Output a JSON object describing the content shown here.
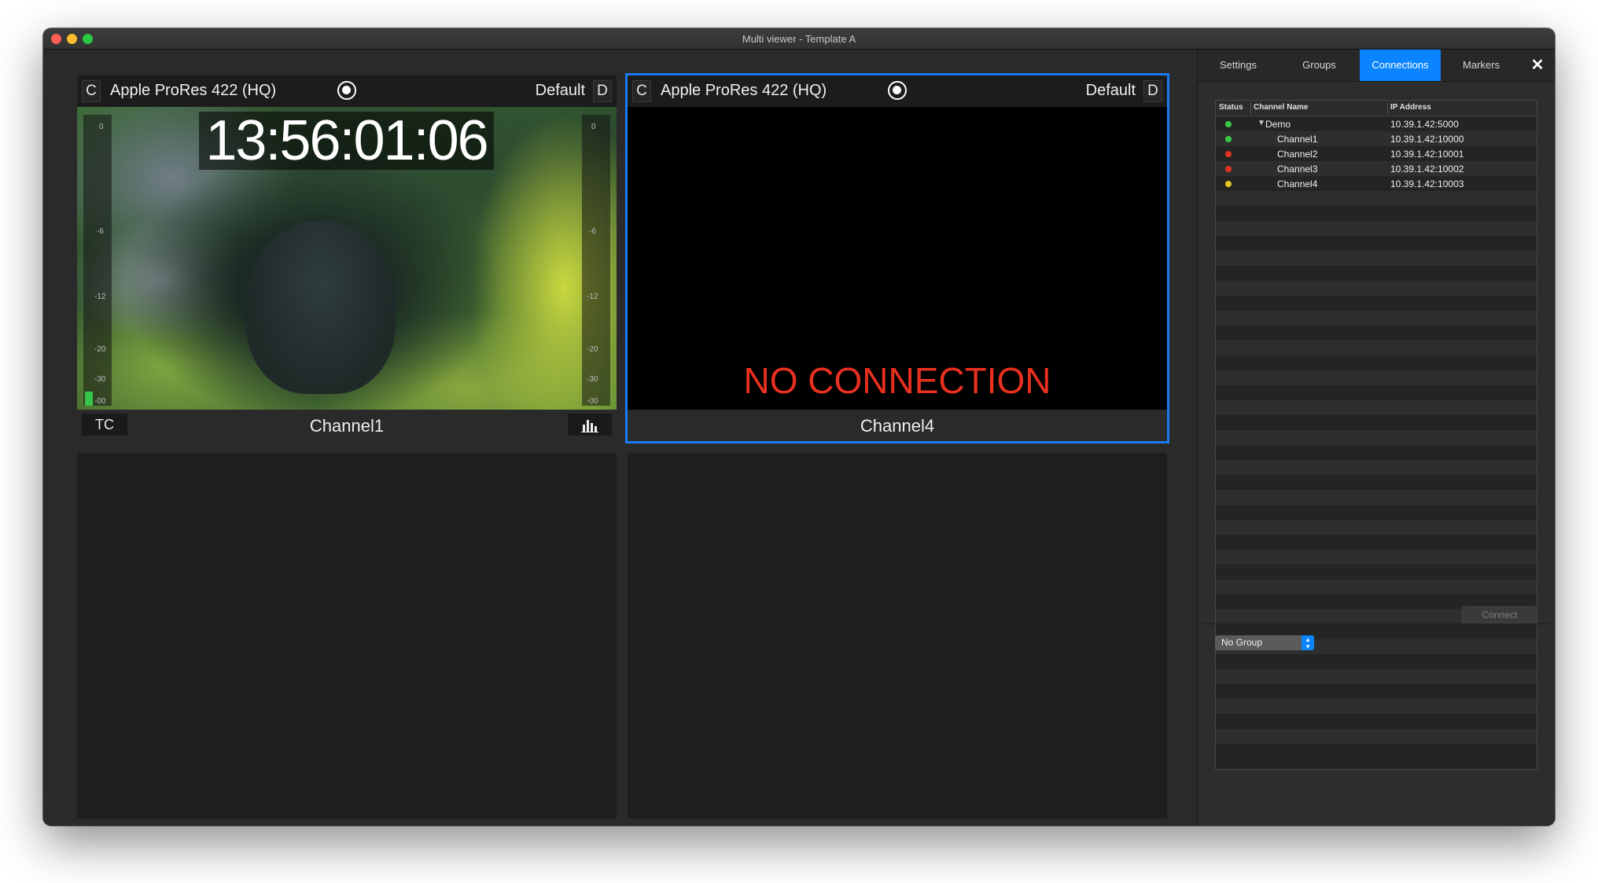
{
  "window": {
    "title": "Multi viewer - Template A"
  },
  "tiles": [
    {
      "left_box": "C",
      "codec": "Apple ProRes 422 (HQ)",
      "preset": "Default",
      "right_box": "D",
      "timecode": "13:56:01:06",
      "tc_button": "TC",
      "channel": "Channel1",
      "meter_ticks": [
        "0",
        "-6",
        "-12",
        "-20",
        "-30",
        "-00"
      ]
    },
    {
      "left_box": "C",
      "codec": "Apple ProRes 422 (HQ)",
      "preset": "Default",
      "right_box": "D",
      "status": "NO CONNECTION",
      "channel": "Channel4"
    }
  ],
  "side": {
    "tabs": [
      "Settings",
      "Groups",
      "Connections",
      "Markers"
    ],
    "active_tab": "Connections",
    "table": {
      "columns": [
        "Status",
        "Channel Name",
        "IP Address"
      ],
      "rows": [
        {
          "status": "green",
          "name": "Demo",
          "ip": "10.39.1.42:5000",
          "group": true
        },
        {
          "status": "green",
          "name": "Channel1",
          "ip": "10.39.1.42:10000"
        },
        {
          "status": "red",
          "name": "Channel2",
          "ip": "10.39.1.42:10001"
        },
        {
          "status": "red",
          "name": "Channel3",
          "ip": "10.39.1.42:10002"
        },
        {
          "status": "yellow",
          "name": "Channel4",
          "ip": "10.39.1.42:10003"
        }
      ]
    },
    "connect_label": "Connect",
    "group_select": "No Group"
  },
  "colors": {
    "accent": "#0a84ff",
    "status_green": "#38c948",
    "status_red": "#e2311f",
    "status_yellow": "#e3c51d",
    "no_connection": "#e8301f"
  }
}
